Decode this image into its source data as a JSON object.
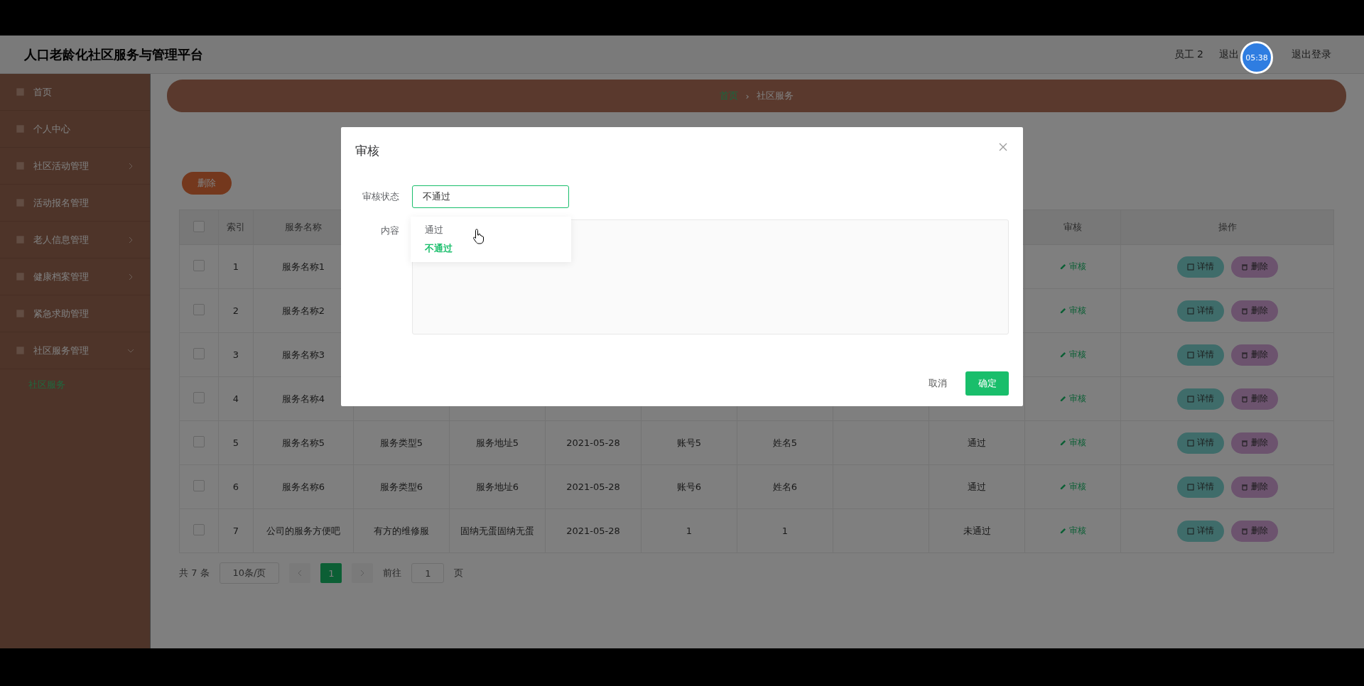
{
  "header": {
    "title": "人口老龄化社区服务与管理平台",
    "user": "员工 2",
    "logout_partial": "退出",
    "logout": "退出登录"
  },
  "recorder_badge": "05:38",
  "sidebar": {
    "items": [
      {
        "label": "首页",
        "expandable": false
      },
      {
        "label": "个人中心",
        "expandable": false
      },
      {
        "label": "社区活动管理",
        "expandable": true
      },
      {
        "label": "活动报名管理",
        "expandable": false
      },
      {
        "label": "老人信息管理",
        "expandable": true
      },
      {
        "label": "健康档案管理",
        "expandable": true
      },
      {
        "label": "紧急求助管理",
        "expandable": false
      },
      {
        "label": "社区服务管理",
        "expandable": true,
        "expanded": true,
        "children": [
          {
            "label": "社区服务",
            "selected": true
          }
        ]
      }
    ]
  },
  "breadcrumb": {
    "items": [
      "首页",
      "社区服务"
    ],
    "separator": "›"
  },
  "delete_button": "删除",
  "table": {
    "select_all_checked": false,
    "columns": [
      "索引",
      "服务名称",
      null,
      null,
      null,
      null,
      null,
      null,
      null,
      "审核",
      "操作"
    ],
    "rows": [
      {
        "checked": false,
        "cells": [
          "1",
          "服务名称1",
          null,
          null,
          null,
          null,
          null,
          null,
          null
        ],
        "audit": "审核",
        "actions": [
          "详情",
          "删除"
        ]
      },
      {
        "checked": false,
        "cells": [
          "2",
          "服务名称2",
          null,
          null,
          null,
          null,
          null,
          null,
          null
        ],
        "audit": "审核",
        "actions": [
          "详情",
          "删除"
        ]
      },
      {
        "checked": false,
        "cells": [
          "3",
          "服务名称3",
          null,
          null,
          null,
          null,
          null,
          null,
          null
        ],
        "audit": "审核",
        "actions": [
          "详情",
          "删除"
        ]
      },
      {
        "checked": false,
        "cells": [
          "4",
          "服务名称4",
          null,
          null,
          null,
          null,
          null,
          null,
          null
        ],
        "audit": "审核",
        "actions": [
          "详情",
          "删除"
        ]
      },
      {
        "checked": false,
        "cells": [
          "5",
          "服务名称5",
          "服务类型5",
          "服务地址5",
          "2021-05-28",
          "账号5",
          "姓名5",
          null,
          "通过"
        ],
        "audit": "审核",
        "actions": [
          "详情",
          "删除"
        ]
      },
      {
        "checked": false,
        "cells": [
          "6",
          "服务名称6",
          "服务类型6",
          "服务地址6",
          "2021-05-28",
          "账号6",
          "姓名6",
          null,
          "通过"
        ],
        "audit": "审核",
        "actions": [
          "详情",
          "删除"
        ]
      },
      {
        "checked": false,
        "cells": [
          "7",
          "公司的服务方便吧",
          "有方的维修服",
          "固纳无蛋固纳无蛋",
          "2021-05-28",
          "1",
          "1",
          null,
          "未通过"
        ],
        "audit": "审核",
        "actions": [
          "详情",
          "删除"
        ]
      }
    ]
  },
  "pagination": {
    "total": "共 7 条",
    "page_size": "10条/页",
    "pages": [
      {
        "label": "1",
        "selected": true
      }
    ],
    "goto_label": "前往",
    "goto_value": "1",
    "goto_suffix": "页"
  },
  "dialog": {
    "title": "审核",
    "status_label": "审核状态",
    "status_value": "不通过",
    "options": [
      {
        "label": "通过",
        "selected": false
      },
      {
        "label": "不通过",
        "selected": true
      }
    ],
    "content_label": "内容",
    "cancel": "取消",
    "confirm": "确定"
  }
}
